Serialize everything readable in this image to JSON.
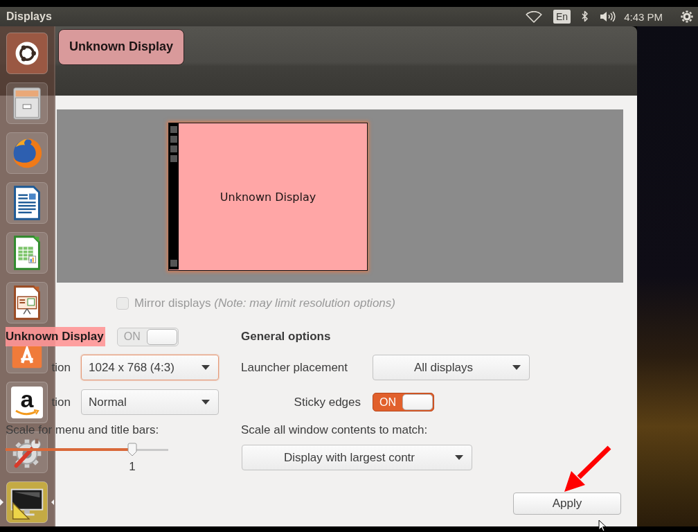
{
  "top_panel": {
    "title": "Displays",
    "keyboard_layout": "En",
    "clock": "4:43 PM"
  },
  "launcher": {
    "items": [
      {
        "kind": "dash",
        "active": false
      },
      {
        "kind": "files",
        "active": false
      },
      {
        "kind": "browser",
        "active": false
      },
      {
        "kind": "writer",
        "active": false
      },
      {
        "kind": "calc",
        "active": false
      },
      {
        "kind": "impress",
        "active": false
      },
      {
        "kind": "software",
        "active": false
      },
      {
        "kind": "store",
        "glyph": "a",
        "active": false
      },
      {
        "kind": "settings",
        "active": false
      },
      {
        "kind": "displays",
        "active": true
      }
    ]
  },
  "window": {
    "display_name_label": "Unknown Display",
    "arrangement": {
      "displays": [
        {
          "name": "Unknown Display"
        }
      ]
    },
    "mirror": {
      "label": "Mirror displays *(Note: may limit resolution options)*",
      "checked": false,
      "disabled": true
    },
    "display": {
      "name": "Unknown Display",
      "switch": {
        "text": "ON",
        "on": true,
        "disabled": true
      },
      "fields": [
        {
          "label": "tion",
          "value": "1024 x 768 (4:3)",
          "focused": true
        },
        {
          "label": "tion",
          "value": "Normal",
          "focused": false
        }
      ],
      "scale": {
        "label": "Scale for menu and title bars:",
        "level": 0.78,
        "reading": "1"
      }
    },
    "general": {
      "heading": "General options",
      "launcher_placement": {
        "label": "Launcher placement",
        "value": "All displays"
      },
      "sticky_edges": {
        "label": "Sticky edges",
        "switch": {
          "text": "ON",
          "on": true,
          "disabled": false
        }
      },
      "scale_all": {
        "label": "Scale all window contents to match:",
        "value": "Display with largest contr"
      }
    },
    "buttons": [
      "Apply"
    ]
  }
}
